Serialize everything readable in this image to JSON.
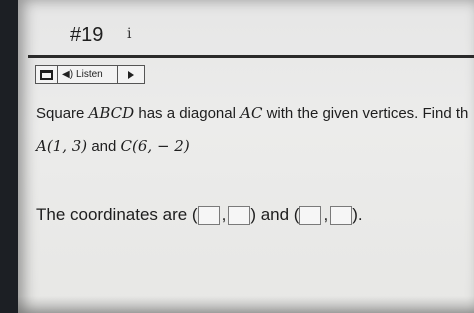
{
  "question": {
    "number": "#19",
    "info_icon": "i"
  },
  "toolbar": {
    "menu_icon": "toolbar-box-icon",
    "speaker_icon": "speaker-icon",
    "listen_label": "Listen",
    "play_icon": "play-icon"
  },
  "prompt": {
    "part1": "Square ",
    "shape": "ABCD",
    "part2": " has a diagonal ",
    "diagonal": "AC",
    "part3": "  with the given vertices. Find th"
  },
  "vertices": {
    "a": "A(1, 3)",
    "and": " and ",
    "c": "C(6, − 2)"
  },
  "answer": {
    "lead": "The coordinates are (",
    "comma": ",",
    "mid": ") and (",
    "end": ")."
  }
}
